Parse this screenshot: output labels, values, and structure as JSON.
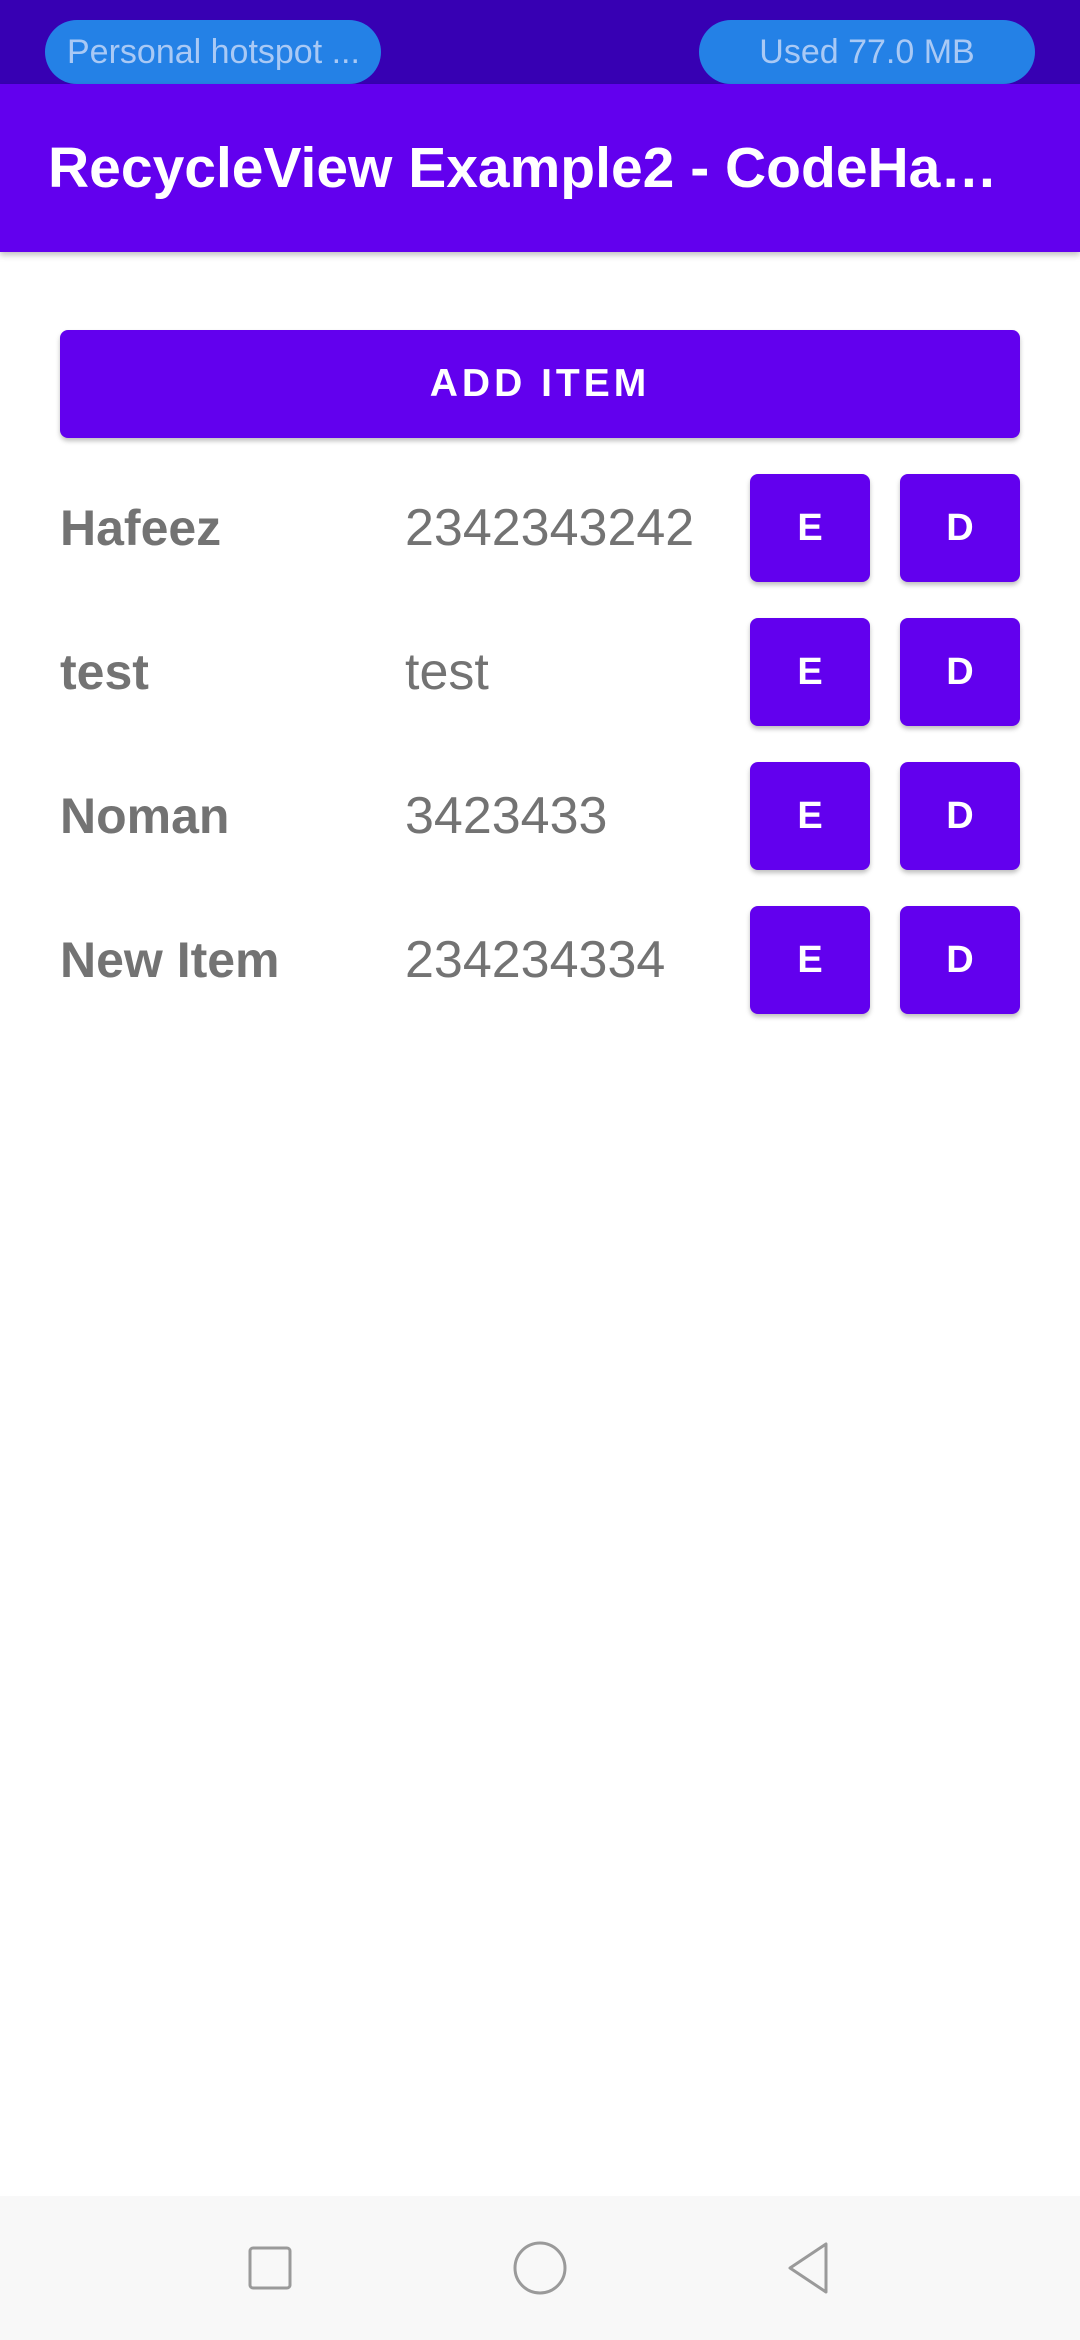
{
  "status_bar": {
    "hotspot_label": "Personal hotspot ...",
    "data_usage": "Used  77.0 MB"
  },
  "app_bar": {
    "title": "RecycleView Example2 - CodeHa…"
  },
  "actions": {
    "add_item_label": "ADD ITEM"
  },
  "items": [
    {
      "name": "Hafeez",
      "value": "2342343242",
      "edit_label": "E",
      "delete_label": "D"
    },
    {
      "name": "test",
      "value": "test",
      "edit_label": "E",
      "delete_label": "D"
    },
    {
      "name": "Noman",
      "value": "3423433",
      "edit_label": "E",
      "delete_label": "D"
    },
    {
      "name": "New Item",
      "value": "234234334",
      "edit_label": "E",
      "delete_label": "D"
    }
  ],
  "nav_bar": {
    "icons": [
      "recents-icon",
      "home-icon",
      "back-icon"
    ]
  },
  "colors": {
    "status_bar": "#3700b3",
    "primary": "#6200ee",
    "pill": "#2481e6",
    "text_gray": "#737373",
    "nav_bar": "#f8f8f8"
  }
}
